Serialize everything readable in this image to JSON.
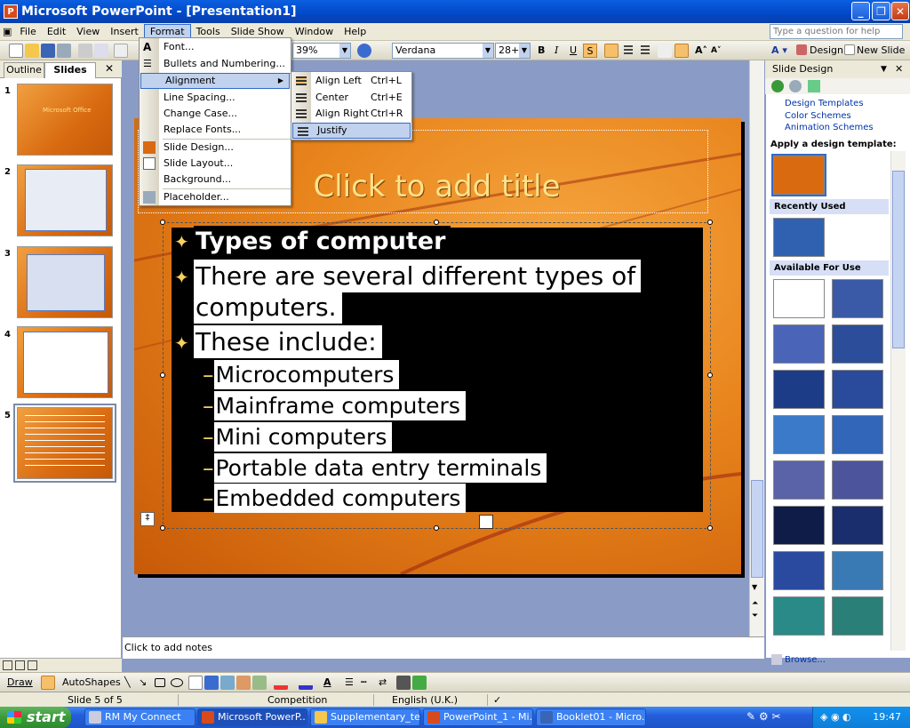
{
  "window": {
    "title": "Microsoft PowerPoint - [Presentation1]",
    "app_icon": "P"
  },
  "menubar": {
    "items": [
      "File",
      "Edit",
      "View",
      "Insert",
      "Format",
      "Tools",
      "Slide Show",
      "Window",
      "Help"
    ],
    "active": "Format",
    "help_placeholder": "Type a question for help"
  },
  "toolbar": {
    "zoom": "39%",
    "font": "Verdana",
    "size": "28+",
    "bold": "B",
    "italic": "I",
    "underline": "U",
    "shadow": "S",
    "design_label": "Design",
    "new_slide_label": "New Slide"
  },
  "left_pane": {
    "tabs": [
      "Outline",
      "Slides"
    ],
    "close": "✕",
    "slide_numbers": [
      "1",
      "2",
      "3",
      "4",
      "5"
    ],
    "thumb1_text": "Microsoft Office"
  },
  "format_menu": {
    "items": [
      "Font...",
      "Bullets and Numbering...",
      "Alignment",
      "Line Spacing...",
      "Change Case...",
      "Replace Fonts...",
      "Slide Design...",
      "Slide Layout...",
      "Background...",
      "Placeholder..."
    ]
  },
  "alignment_submenu": {
    "items": [
      {
        "label": "Align Left",
        "shortcut": "Ctrl+L"
      },
      {
        "label": "Center",
        "shortcut": "Ctrl+E"
      },
      {
        "label": "Align Right",
        "shortcut": "Ctrl+R"
      },
      {
        "label": "Justify",
        "shortcut": ""
      }
    ]
  },
  "slide": {
    "title_placeholder": "Click to add title",
    "bullets": [
      {
        "level": 1,
        "text": "Types of computer"
      },
      {
        "level": 1,
        "text": "There are several different types of",
        "cont": "computers."
      },
      {
        "level": 1,
        "text": "These include:"
      },
      {
        "level": 2,
        "text": "Microcomputers"
      },
      {
        "level": 2,
        "text": "Mainframe computers"
      },
      {
        "level": 2,
        "text": "Mini computers"
      },
      {
        "level": 2,
        "text": "Portable data entry terminals"
      },
      {
        "level": 2,
        "text": "Embedded computers"
      }
    ],
    "bullet_dash": "–"
  },
  "notes": {
    "placeholder": "Click to add notes"
  },
  "task_pane": {
    "title": "Slide Design",
    "links": [
      "Design Templates",
      "Color Schemes",
      "Animation Schemes"
    ],
    "apply_label": "Apply a design template:",
    "recently_used": "Recently Used",
    "available": "Available For Use",
    "browse": "Browse..."
  },
  "drawbar": {
    "draw_label": "Draw",
    "autoshapes_label": "AutoShapes"
  },
  "status": {
    "slide": "Slide 5 of 5",
    "design": "Competition",
    "language": "English (U.K.)"
  },
  "taskbar": {
    "start": "start",
    "buttons": [
      "RM My Connect",
      "Microsoft PowerP...",
      "Supplementary_te...",
      "PowerPoint_1 - Mi...",
      "Booklet01 - Micro..."
    ],
    "clock": "19:47"
  },
  "colors": {
    "slide_orange": "#e8841c",
    "title_yellow": "#ffe38a",
    "xp_blue": "#245edb"
  }
}
